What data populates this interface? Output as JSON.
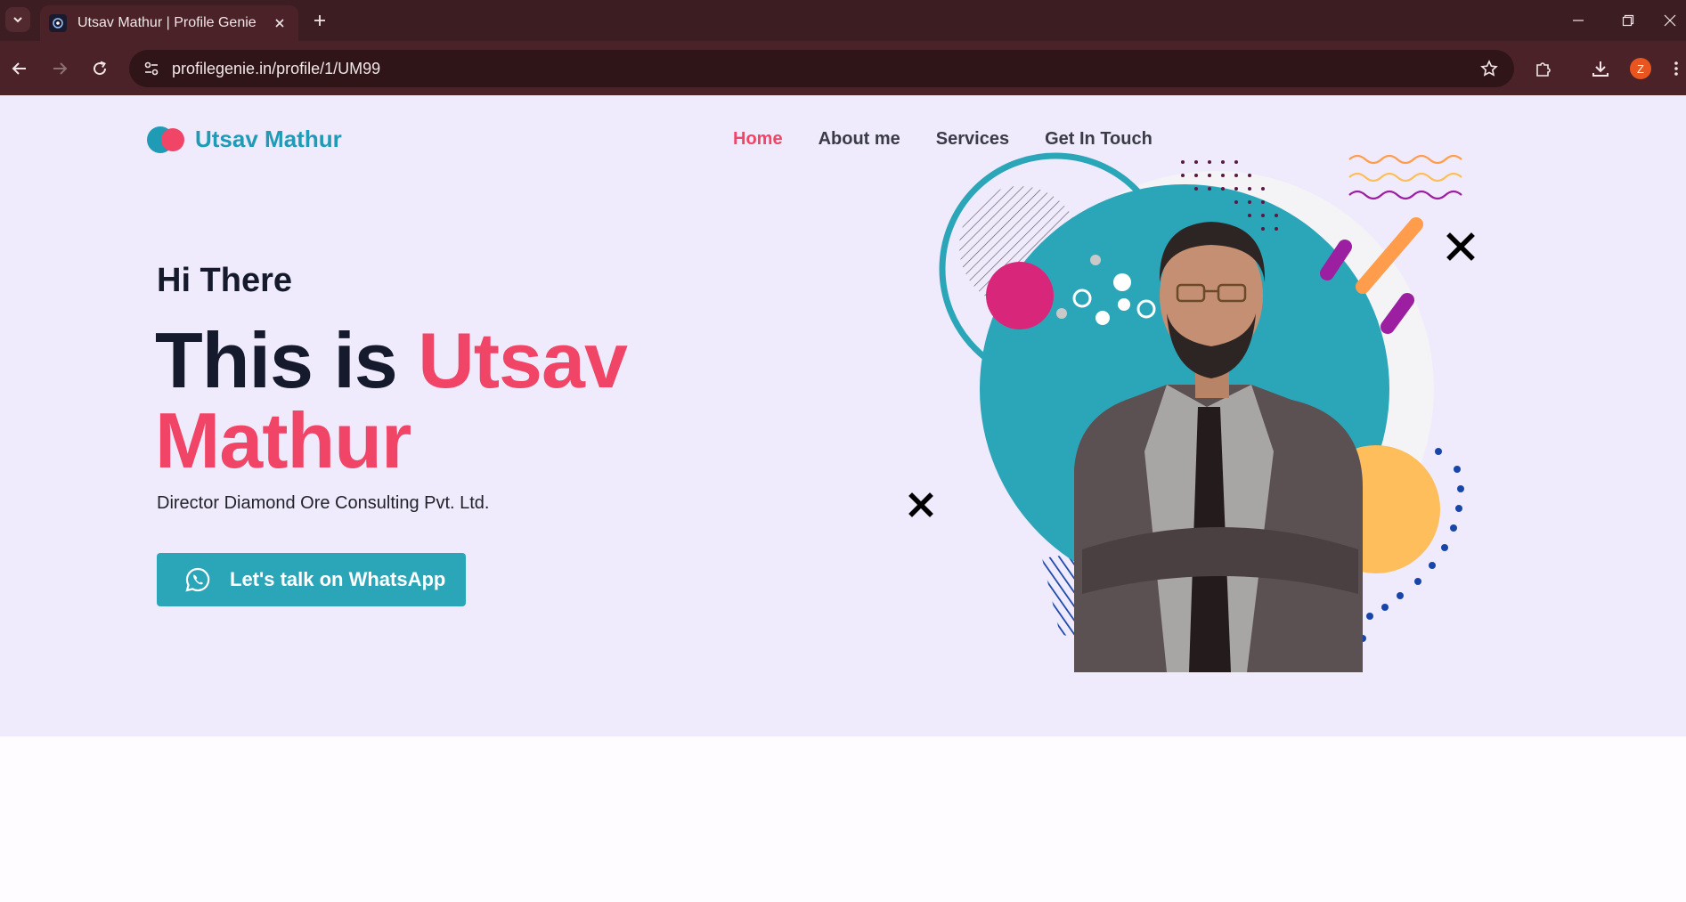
{
  "browser": {
    "tab_title": "Utsav Mathur | Profile Genie",
    "url": "profilegenie.in/profile/1/UM99",
    "profile_initial": "Z"
  },
  "site": {
    "brand": "Utsav Mathur",
    "nav": [
      {
        "label": "Home",
        "active": true
      },
      {
        "label": "About me",
        "active": false
      },
      {
        "label": "Services",
        "active": false
      },
      {
        "label": "Get In Touch",
        "active": false
      }
    ],
    "hero": {
      "greeting": "Hi There",
      "headline_prefix": "This is",
      "headline_name_line1": "Utsav",
      "headline_name_line2": "Mathur",
      "subtitle": "Director Diamond Ore Consulting Pvt. Ltd.",
      "cta_label": "Let's talk on WhatsApp",
      "cta_icon": "whatsapp-icon"
    }
  },
  "colors": {
    "accent": "#f04566",
    "brand": "#1f9bb5",
    "hero_bg": "#efebfc",
    "cta_bg": "#2ba6b8"
  }
}
